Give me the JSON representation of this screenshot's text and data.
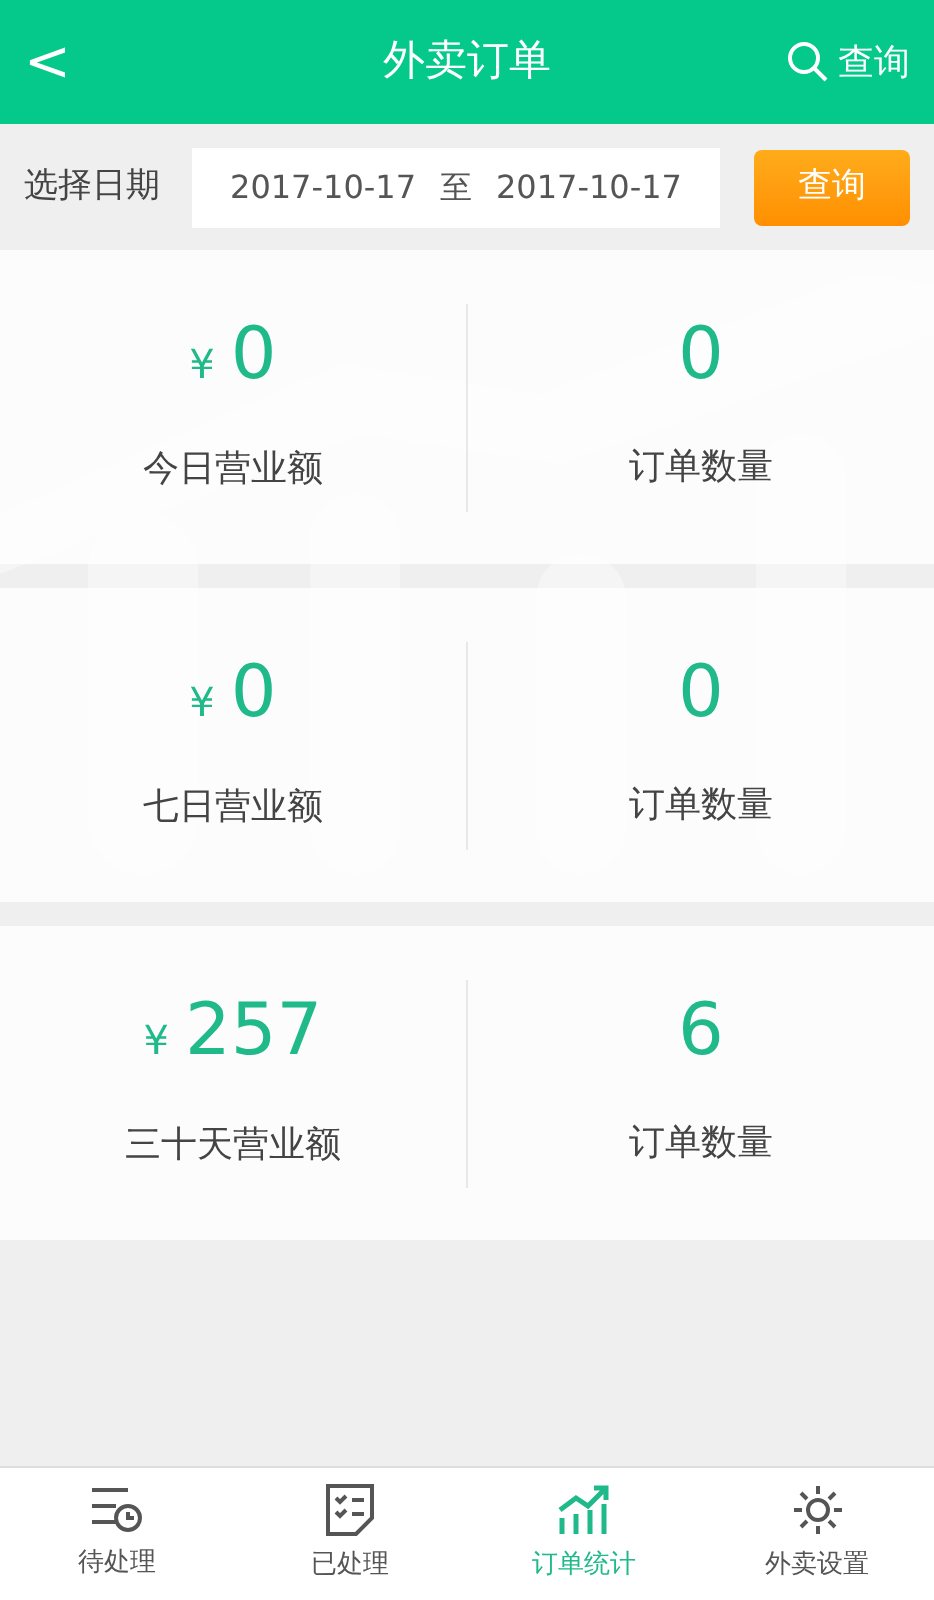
{
  "header": {
    "back": "<",
    "title": "外卖订单",
    "search": "查询"
  },
  "date_filter": {
    "label": "选择日期",
    "start": "2017-10-17",
    "separator": "至",
    "end": "2017-10-17",
    "button": "查询"
  },
  "stats": [
    {
      "currency": "¥",
      "amount": "0",
      "amount_label": "今日营业额",
      "count": "0",
      "count_label": "订单数量"
    },
    {
      "currency": "¥",
      "amount": "0",
      "amount_label": "七日营业额",
      "count": "0",
      "count_label": "订单数量"
    },
    {
      "currency": "¥",
      "amount": "257",
      "amount_label": "三十天营业额",
      "count": "6",
      "count_label": "订单数量"
    }
  ],
  "tabs": [
    {
      "kind": "pending",
      "label": "待处理",
      "selected": false
    },
    {
      "kind": "done",
      "label": "已处理",
      "selected": false
    },
    {
      "kind": "stats",
      "label": "订单统计",
      "selected": true
    },
    {
      "kind": "settings",
      "label": "外卖设置",
      "selected": false
    }
  ]
}
